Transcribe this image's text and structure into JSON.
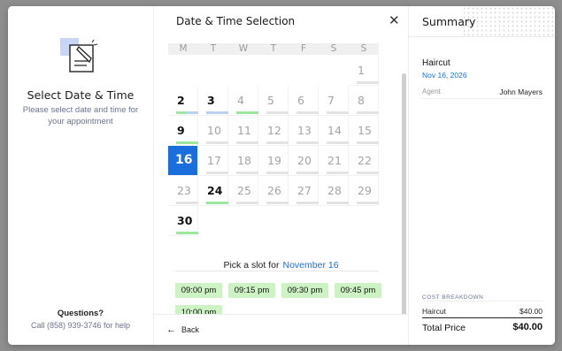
{
  "left": {
    "title": "Select Date & Time",
    "subtitle": "Please select date and time for your appointment",
    "questions": "Questions?",
    "phone": "Call (858) 939-3746 for help"
  },
  "center": {
    "title": "Date & Time Selection",
    "weekdays": [
      "M",
      "T",
      "W",
      "T",
      "F",
      "S",
      "S"
    ],
    "slot_prefix": "Pick a slot for",
    "slot_date": "November 16",
    "slots": [
      "09:00 pm",
      "09:15 pm",
      "09:30 pm",
      "09:45 pm",
      "10:00 pm"
    ],
    "back_label": "Back",
    "accent": "#1b6fdc",
    "slot_color": "#cdf3c4",
    "days": [
      {
        "n": "1",
        "col": 6,
        "row": 0,
        "avail": false,
        "bar": "gray"
      },
      {
        "n": "2",
        "col": 0,
        "row": 1,
        "avail": true,
        "bar": "green-blue"
      },
      {
        "n": "3",
        "col": 1,
        "row": 1,
        "avail": true,
        "bar": "blue"
      },
      {
        "n": "4",
        "col": 2,
        "row": 1,
        "avail": false,
        "bar": "green"
      },
      {
        "n": "5",
        "col": 3,
        "row": 1,
        "avail": false,
        "bar": "gray"
      },
      {
        "n": "6",
        "col": 4,
        "row": 1,
        "avail": false,
        "bar": "gray"
      },
      {
        "n": "7",
        "col": 5,
        "row": 1,
        "avail": false,
        "bar": "gray"
      },
      {
        "n": "8",
        "col": 6,
        "row": 1,
        "avail": false,
        "bar": "gray"
      },
      {
        "n": "9",
        "col": 0,
        "row": 2,
        "avail": true,
        "bar": "green"
      },
      {
        "n": "10",
        "col": 1,
        "row": 2,
        "avail": false,
        "bar": "gray"
      },
      {
        "n": "11",
        "col": 2,
        "row": 2,
        "avail": false,
        "bar": "gray"
      },
      {
        "n": "12",
        "col": 3,
        "row": 2,
        "avail": false,
        "bar": "gray"
      },
      {
        "n": "13",
        "col": 4,
        "row": 2,
        "avail": false,
        "bar": "gray"
      },
      {
        "n": "14",
        "col": 5,
        "row": 2,
        "avail": false,
        "bar": "gray"
      },
      {
        "n": "15",
        "col": 6,
        "row": 2,
        "avail": false,
        "bar": "gray"
      },
      {
        "n": "16",
        "col": 0,
        "row": 3,
        "avail": true,
        "bar": "none",
        "selected": true
      },
      {
        "n": "17",
        "col": 1,
        "row": 3,
        "avail": false,
        "bar": "gray"
      },
      {
        "n": "18",
        "col": 2,
        "row": 3,
        "avail": false,
        "bar": "gray"
      },
      {
        "n": "19",
        "col": 3,
        "row": 3,
        "avail": false,
        "bar": "gray"
      },
      {
        "n": "20",
        "col": 4,
        "row": 3,
        "avail": false,
        "bar": "gray"
      },
      {
        "n": "21",
        "col": 5,
        "row": 3,
        "avail": false,
        "bar": "gray"
      },
      {
        "n": "22",
        "col": 6,
        "row": 3,
        "avail": false,
        "bar": "gray"
      },
      {
        "n": "23",
        "col": 0,
        "row": 4,
        "avail": false,
        "bar": "gray"
      },
      {
        "n": "24",
        "col": 1,
        "row": 4,
        "avail": true,
        "bar": "green"
      },
      {
        "n": "25",
        "col": 2,
        "row": 4,
        "avail": false,
        "bar": "gray"
      },
      {
        "n": "26",
        "col": 3,
        "row": 4,
        "avail": false,
        "bar": "gray"
      },
      {
        "n": "27",
        "col": 4,
        "row": 4,
        "avail": false,
        "bar": "gray"
      },
      {
        "n": "28",
        "col": 5,
        "row": 4,
        "avail": false,
        "bar": "gray"
      },
      {
        "n": "29",
        "col": 6,
        "row": 4,
        "avail": false,
        "bar": "gray"
      },
      {
        "n": "30",
        "col": 0,
        "row": 5,
        "avail": true,
        "bar": "green"
      }
    ]
  },
  "summary": {
    "title": "Summary",
    "service": "Haircut",
    "date": "Nov 16, 2026",
    "agent_label": "Agent",
    "agent_name": "John Mayers",
    "cost_header": "COST BREAKDOWN",
    "cost_item": "Haircut",
    "cost_item_price": "$40.00",
    "total_label": "Total Price",
    "total_value": "$40.00"
  }
}
